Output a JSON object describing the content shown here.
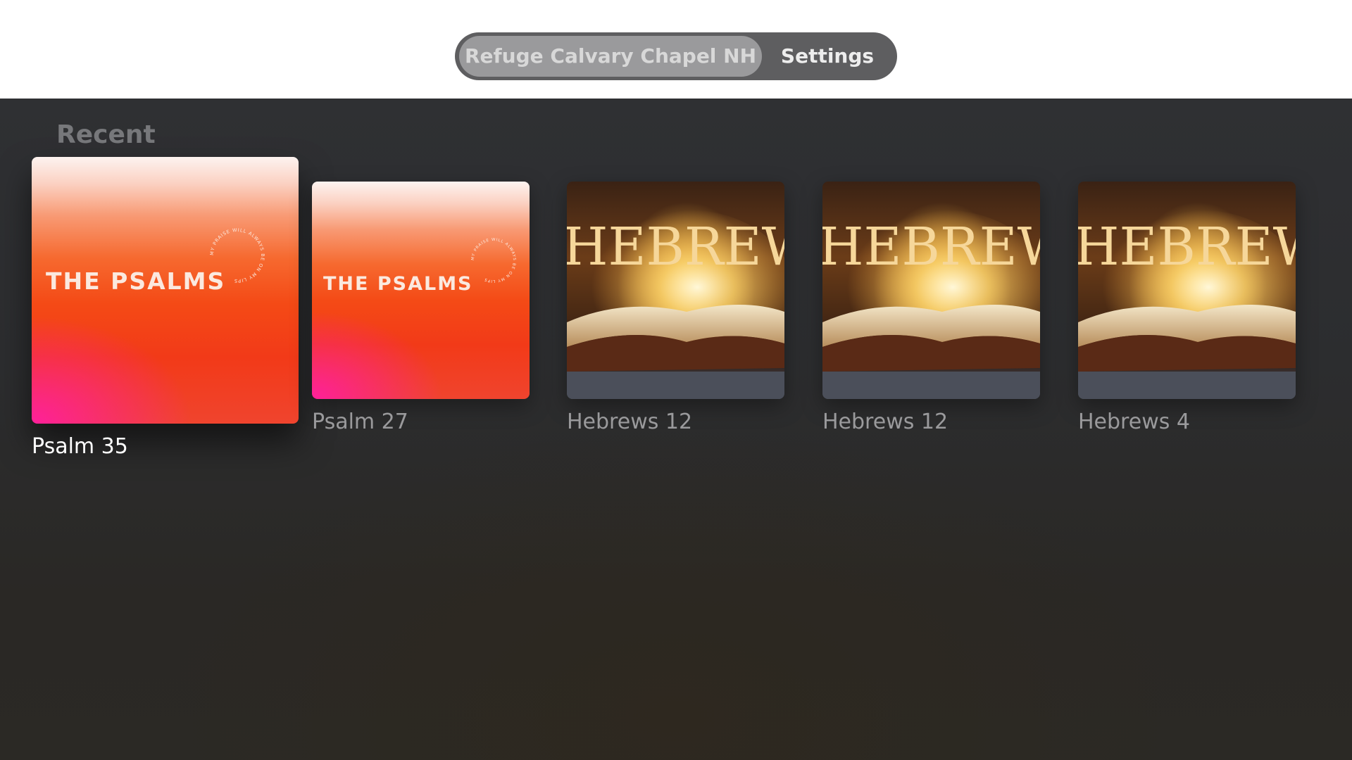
{
  "top_nav": {
    "tabs": [
      {
        "label": "Refuge Calvary Chapel NH",
        "selected": true
      },
      {
        "label": "Settings",
        "selected": false
      }
    ]
  },
  "recent": {
    "title": "Recent",
    "items": [
      {
        "title": "Psalm 35",
        "art_text": "THE PSALMS",
        "art_ring_text": "MY PRAISE WILL ALWAYS BE ON MY LIPS",
        "focused": true,
        "art": "psalms"
      },
      {
        "title": "Psalm 27",
        "art_text": "THE PSALMS",
        "art_ring_text": "MY PRAISE WILL ALWAYS BE ON MY LIPS",
        "focused": false,
        "art": "psalms"
      },
      {
        "title": "Hebrews 12",
        "art_text": "HEBREWS",
        "focused": false,
        "art": "hebrews"
      },
      {
        "title": "Hebrews 12",
        "art_text": "HEBREWS",
        "focused": false,
        "art": "hebrews"
      },
      {
        "title": "Hebrews 4",
        "art_text": "HEBREWS",
        "focused": false,
        "art": "hebrews"
      }
    ]
  },
  "colors": {
    "nav_pill": "#5e5e60",
    "nav_selected": "#9a9a9c",
    "background": "#2e2f31",
    "psalms_orange": "#f44a16",
    "psalms_pink": "#ff1ea0"
  }
}
